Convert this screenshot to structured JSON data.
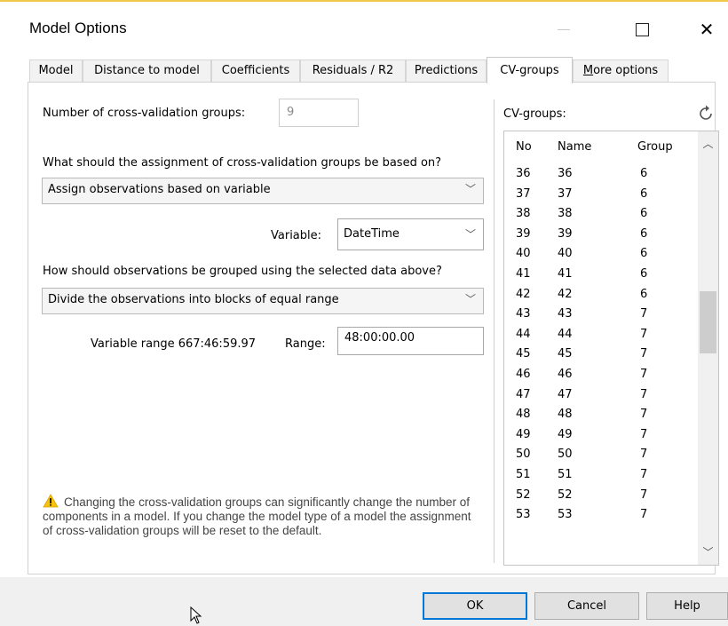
{
  "window": {
    "title": "Model Options",
    "accent_color": "#f0c84a"
  },
  "tabs": [
    {
      "label": "Model"
    },
    {
      "label": "Distance to model"
    },
    {
      "label": "Coefficients"
    },
    {
      "label": "Residuals / R2"
    },
    {
      "label": "Predictions"
    },
    {
      "label": "CV-groups",
      "active": true
    },
    {
      "label": "More options"
    }
  ],
  "cv": {
    "num_groups_label": "Number of cross-validation groups:",
    "num_groups_value": "9",
    "assignment_question": "What should the assignment of cross-validation groups be based on?",
    "assignment_selected": "Assign observations based on variable",
    "variable_label": "Variable:",
    "variable_selected": "DateTime",
    "grouping_question": "How should observations be grouped using the selected data above?",
    "grouping_selected": "Divide the observations into blocks of equal range",
    "variable_range_label": "Variable range 667:46:59.97",
    "range_label": "Range:",
    "range_value": "48:00:00.00"
  },
  "groups_list": {
    "title": "CV-groups:",
    "refresh_icon": "refresh-icon",
    "columns": [
      "No",
      "Name",
      "Group"
    ],
    "rows": [
      [
        "36",
        "36",
        "6"
      ],
      [
        "37",
        "37",
        "6"
      ],
      [
        "38",
        "38",
        "6"
      ],
      [
        "39",
        "39",
        "6"
      ],
      [
        "40",
        "40",
        "6"
      ],
      [
        "41",
        "41",
        "6"
      ],
      [
        "42",
        "42",
        "6"
      ],
      [
        "43",
        "43",
        "7"
      ],
      [
        "44",
        "44",
        "7"
      ],
      [
        "45",
        "45",
        "7"
      ],
      [
        "46",
        "46",
        "7"
      ],
      [
        "47",
        "47",
        "7"
      ],
      [
        "48",
        "48",
        "7"
      ],
      [
        "49",
        "49",
        "7"
      ],
      [
        "50",
        "50",
        "7"
      ],
      [
        "51",
        "51",
        "7"
      ],
      [
        "52",
        "52",
        "7"
      ],
      [
        "53",
        "53",
        "7"
      ]
    ]
  },
  "warning": {
    "icon": "warning-icon",
    "text": "Changing the cross-validation groups can significantly change the number of components in a model. If you change the model type of a model the assignment of cross-validation groups will be reset to the default."
  },
  "buttons": {
    "ok": "OK",
    "cancel": "Cancel",
    "help": "Help"
  }
}
